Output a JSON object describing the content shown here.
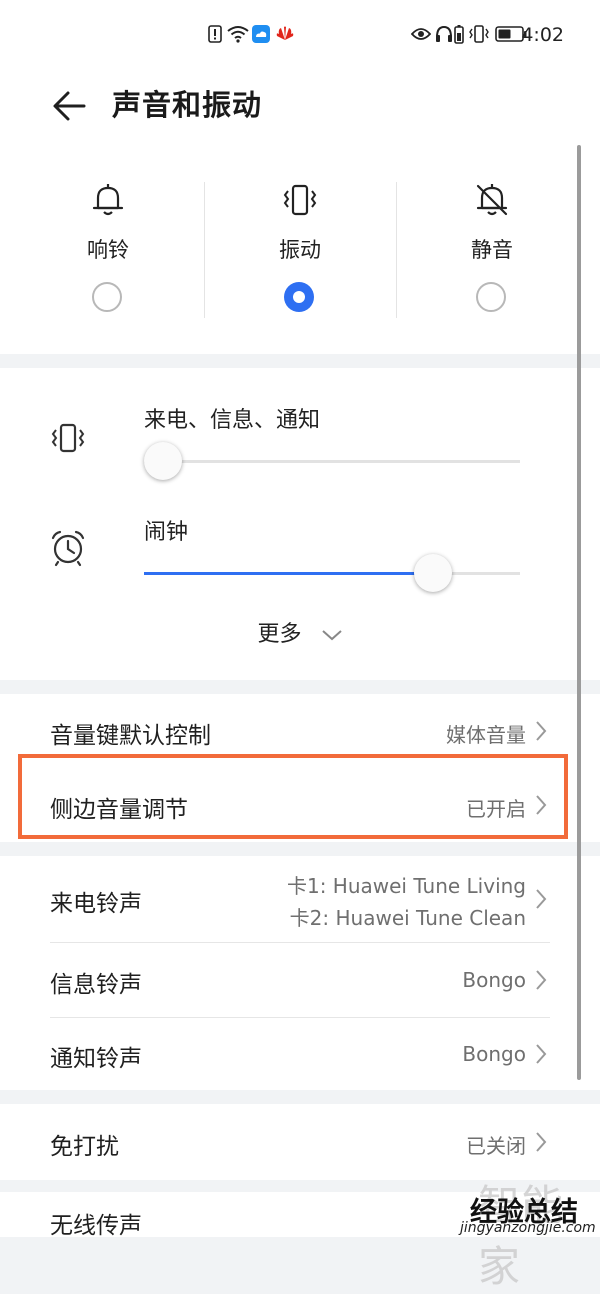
{
  "status_bar": {
    "time": "4:02",
    "icons": [
      "alert-icon",
      "wifi-icon",
      "cloud-icon",
      "huawei-logo-icon",
      "eye-icon",
      "headphones-icon",
      "battery-saver-icon",
      "vibrate-icon",
      "battery-icon"
    ]
  },
  "header": {
    "title": "声音和振动"
  },
  "sound_modes": [
    {
      "label": "响铃",
      "icon": "bell-icon",
      "selected": false
    },
    {
      "label": "振动",
      "icon": "vibrate-icon",
      "selected": true
    },
    {
      "label": "静音",
      "icon": "bell-off-icon",
      "selected": false
    }
  ],
  "volume": {
    "call_label": "来电、信息、通知",
    "call_level": 0,
    "alarm_label": "闹钟",
    "alarm_level": 0.8,
    "more_label": "更多",
    "accent": "#2e6ff2"
  },
  "settings": {
    "volume_key_label": "音量键默认控制",
    "volume_key_value": "媒体音量",
    "side_volume_label": "侧边音量调节",
    "side_volume_value": "已开启",
    "ringtone_label": "来电铃声",
    "ringtone_value_1": "卡1: Huawei Tune Living",
    "ringtone_value_2": "卡2: Huawei Tune Clean",
    "message_label": "信息铃声",
    "message_value": "Bongo",
    "notification_label": "通知铃声",
    "notification_value": "Bongo",
    "dnd_label": "免打扰",
    "dnd_value": "已关闭",
    "wireless_label": "无线传声"
  },
  "highlight_color": "#f26b3a",
  "watermark": {
    "line1": "智能家",
    "line2": "经验总结",
    "line3": "jingyanzongjie.com"
  }
}
